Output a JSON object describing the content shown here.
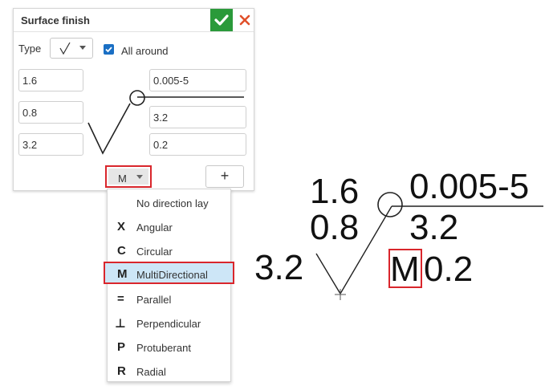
{
  "dialog": {
    "title": "Surface finish",
    "type_label": "Type",
    "all_around_label": "All around",
    "all_around_checked": true,
    "fields": {
      "left_top": "1.6",
      "left_mid": "0.8",
      "left_bottom": "3.2",
      "right_top": "0.005-5",
      "right_mid": "3.2",
      "right_bottom": "0.2"
    },
    "direction_value": "M",
    "add_label": "+"
  },
  "dropdown": {
    "items": [
      {
        "symbol": "",
        "label": "No direction lay"
      },
      {
        "symbol": "X",
        "label": "Angular"
      },
      {
        "symbol": "C",
        "label": "Circular"
      },
      {
        "symbol": "M",
        "label": "MultiDirectional"
      },
      {
        "symbol": "=",
        "label": "Parallel"
      },
      {
        "symbol": "⊥",
        "label": "Perpendicular"
      },
      {
        "symbol": "P",
        "label": "Protuberant"
      },
      {
        "symbol": "R",
        "label": "Radial"
      }
    ],
    "selected": "MultiDirectional"
  },
  "preview": {
    "left_top": "1.6",
    "left_mid": "0.8",
    "left_bottom": "3.2",
    "right_top": "0.005-5",
    "right_mid": "3.2",
    "lay_symbol": "M",
    "right_bottom": "0.2"
  },
  "colors": {
    "accent_ok": "#2a9a3a",
    "cancel": "#e0502a",
    "highlight_border": "#d9262c",
    "selected_bg": "#cde6f7"
  }
}
